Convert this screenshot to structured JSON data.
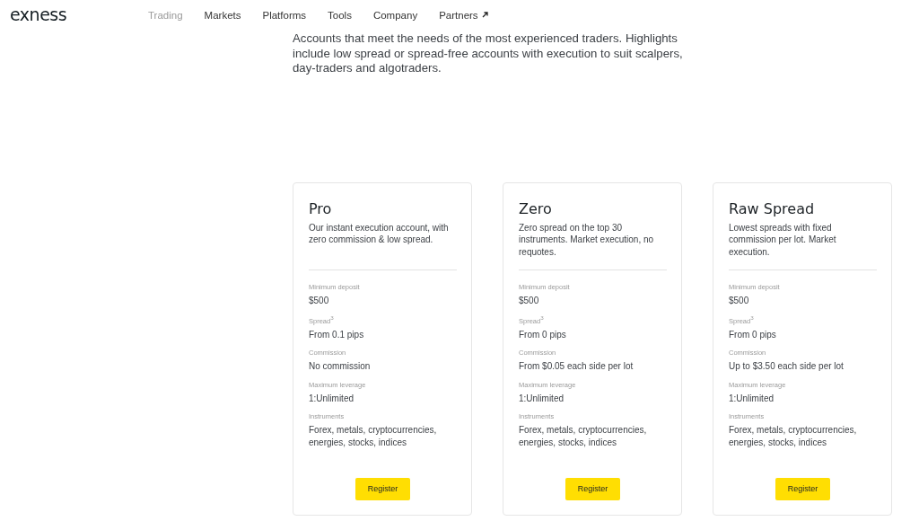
{
  "logo": "exness",
  "nav": [
    {
      "label": "Trading",
      "selected": true,
      "external": false
    },
    {
      "label": "Markets",
      "selected": false,
      "external": false
    },
    {
      "label": "Platforms",
      "selected": false,
      "external": false
    },
    {
      "label": "Tools",
      "selected": false,
      "external": false
    },
    {
      "label": "Company",
      "selected": false,
      "external": false
    },
    {
      "label": "Partners",
      "selected": false,
      "external": true
    }
  ],
  "intro": "Accounts that meet the needs of the most experienced traders. Highlights include low spread or spread-free accounts with execution to suit scalpers, day-traders and algotraders.",
  "cards": [
    {
      "title": "Pro",
      "description": "Our instant execution account, with zero commission & low spread.",
      "specs": [
        {
          "label": "Minimum deposit",
          "value": "$500"
        },
        {
          "label": "Spread$^{3}$",
          "value": "From 0.1 pips"
        },
        {
          "label": "Commission",
          "value": "No commission"
        },
        {
          "label": "Maximum leverage",
          "value": "1:Unlimited"
        },
        {
          "label": "Instruments",
          "value": "Forex, metals, cryptocurrencies, energies, stocks, indices"
        }
      ],
      "button": "Register"
    },
    {
      "title": "Zero",
      "description": "Zero spread on the top 30 instruments. Market execution, no requotes.",
      "specs": [
        {
          "label": "Minimum deposit",
          "value": "$500"
        },
        {
          "label": "Spread$^{3}$",
          "value": "From 0 pips"
        },
        {
          "label": "Commission",
          "value": "From $0.05 each side per lot"
        },
        {
          "label": "Maximum leverage",
          "value": "1:Unlimited"
        },
        {
          "label": "Instruments",
          "value": "Forex, metals, cryptocurrencies, energies, stocks, indices"
        }
      ],
      "button": "Register"
    },
    {
      "title": "Raw Spread",
      "description": "Lowest spreads with fixed commission per lot. Market execution.",
      "specs": [
        {
          "label": "Minimum deposit",
          "value": "$500"
        },
        {
          "label": "Spread$^{3}$",
          "value": "From 0 pips"
        },
        {
          "label": "Commission",
          "value": "Up to $3.50 each side per lot"
        },
        {
          "label": "Maximum leverage",
          "value": "1:Unlimited"
        },
        {
          "label": "Instruments",
          "value": "Forex, metals, cryptocurrencies, energies, stocks, indices"
        }
      ],
      "button": "Register"
    }
  ]
}
